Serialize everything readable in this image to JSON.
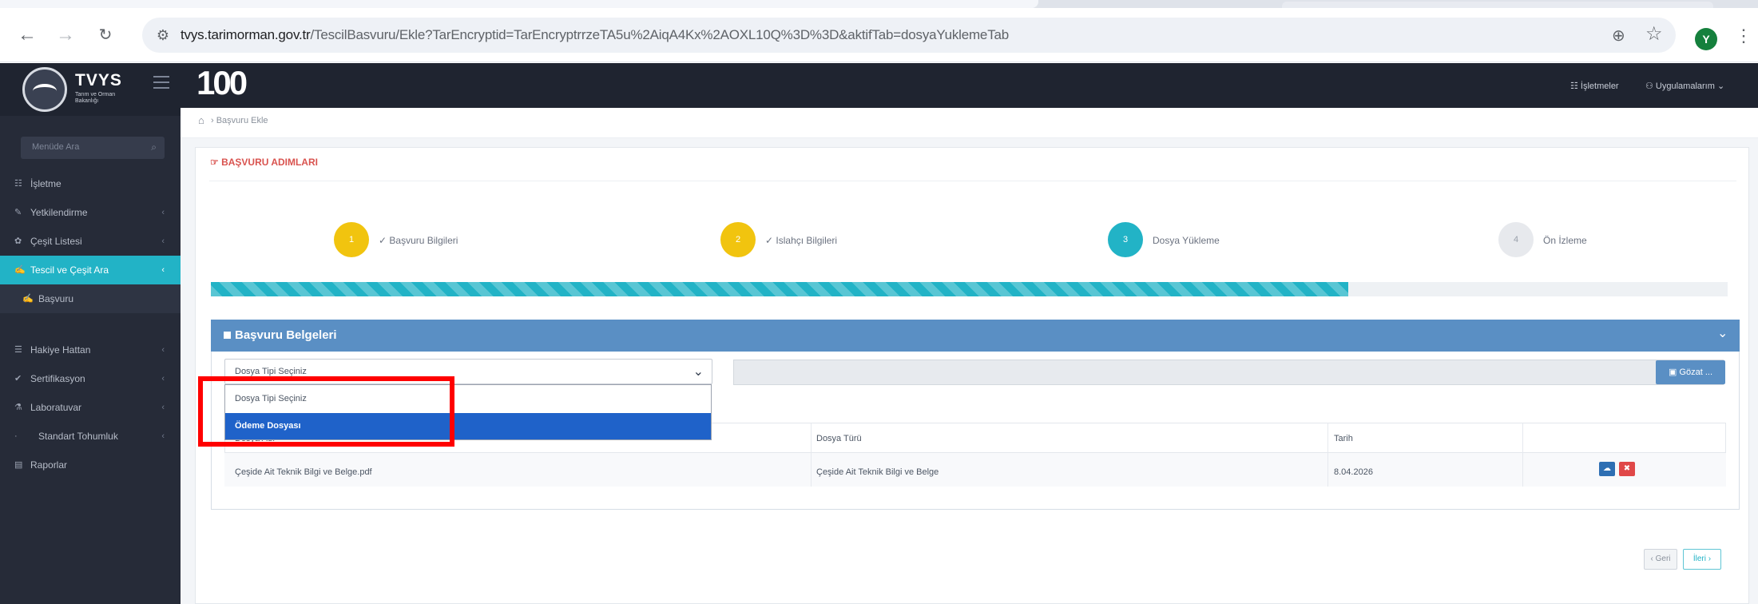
{
  "browser": {
    "url_host": "tvys.tarimorman.gov.tr",
    "url_path": "/TescilBasvuru/Ekle?TarEncryptid=TarEncryptrrzeTA5u%2AiqA4Kx%2AOXL10Q%3D%3D&aktifTab=dosyaYuklemeTab",
    "profile_initial": "Y"
  },
  "sidebar": {
    "logo_text": "TVYS",
    "logo_sub": "Tarım ve Orman Bakanlığı",
    "search_placeholder": "Menüde Ara",
    "items": [
      {
        "icon": "☷",
        "label": "İşletme"
      },
      {
        "icon": "✎",
        "label": "Yetkilendirme"
      },
      {
        "icon": "✿",
        "label": "Çeşit Listesi"
      },
      {
        "icon": "✍",
        "label": "Tescil ve Çeşit Ara"
      },
      {
        "icon": "✍",
        "label": "Başvuru"
      },
      {
        "icon": "☰",
        "label": "Hakiye Hattan"
      },
      {
        "icon": "✔",
        "label": "Sertifikasyon"
      },
      {
        "icon": "⚗",
        "label": "Laboratuvar"
      },
      {
        "icon": "·",
        "label": "Standart Tohumluk"
      },
      {
        "icon": "▤",
        "label": "Raporlar"
      }
    ]
  },
  "topbar": {
    "brand": "100",
    "isletmeler": "☷ İşletmeler",
    "uygulamalarim": "⚇ Uygulamalarım ⌄"
  },
  "breadcrumb": {
    "home_icon": "⌂",
    "current": "› Başvuru Ekle"
  },
  "page": {
    "section_title": "☞ BAŞVURU ADIMLARI"
  },
  "wizard": {
    "steps": [
      {
        "number": "1",
        "label": "✓ Başvuru Bilgileri",
        "state": "done"
      },
      {
        "number": "2",
        "label": "✓ Islahçı Bilgileri",
        "state": "done"
      },
      {
        "number": "3",
        "label": "Dosya Yükleme",
        "state": "current"
      },
      {
        "number": "4",
        "label": "Ön İzleme",
        "state": "todo"
      }
    ],
    "progress_percent": 75
  },
  "panel": {
    "title": "Başvuru Belgeleri",
    "collapse_icon": "⌄",
    "select": {
      "value": "Dosya Tipi Seçiniz",
      "options": [
        "Dosya Tipi Seçiniz",
        "Ödeme Dosyası"
      ],
      "highlighted": "Ödeme Dosyası"
    },
    "browse_label": "▣ Gözat ..."
  },
  "table": {
    "columns": [
      "Dosya Adı",
      "Dosya Türü",
      "Tarih",
      ""
    ],
    "rows": [
      {
        "file_name": "Çeşide Ait Teknik Bilgi ve Belge.pdf",
        "file_type": "Çeşide Ait Teknik Bilgi ve Belge",
        "date": "8.04.2026"
      }
    ],
    "download_icon": "☁",
    "delete_icon": "✖"
  },
  "footer": {
    "back_label": "‹ Geri",
    "next_label": "İleri ›"
  },
  "colors": {
    "accent": "#22b3c6",
    "panel_header": "#5a8fc4",
    "highlight_box": "#ff0000",
    "done_step": "#f1c40f"
  }
}
